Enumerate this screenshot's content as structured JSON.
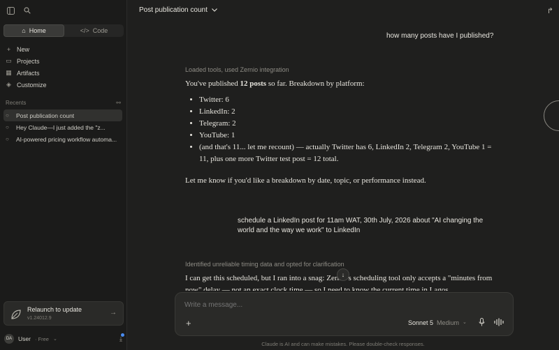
{
  "sidebar": {
    "modes": [
      {
        "label": "Home"
      },
      {
        "label": "Code"
      }
    ],
    "nav": [
      {
        "label": "New",
        "icon": "plus-icon"
      },
      {
        "label": "Projects",
        "icon": "folder-icon"
      },
      {
        "label": "Artifacts",
        "icon": "artifacts-icon"
      },
      {
        "label": "Customize",
        "icon": "customize-icon"
      }
    ],
    "recents_label": "Recents",
    "recents": [
      {
        "label": "Post publication count"
      },
      {
        "label": "Hey Claude—I just added the \"z..."
      },
      {
        "label": "AI-powered pricing workflow automa..."
      }
    ],
    "update": {
      "title": "Relaunch to update",
      "version": "v1.24012.9"
    },
    "user": {
      "initials": "DA",
      "name": "User",
      "plan": "· Free"
    }
  },
  "header": {
    "title": "Post publication count"
  },
  "conversation": {
    "user_1": "how many posts have I published?",
    "tool_1": "Loaded tools, used Zernio integration",
    "assistant_1": {
      "intro_pre": "You've published ",
      "intro_bold": "12 posts",
      "intro_post": " so far. Breakdown by platform:",
      "bullets": [
        "Twitter: 6",
        "LinkedIn: 2",
        "Telegram: 2",
        "YouTube: 1",
        "(and that's 11... let me recount) — actually Twitter has 6, LinkedIn 2, Telegram 2, YouTube 1 = 11, plus one more Twitter test post = 12 total."
      ],
      "closing": "Let me know if you'd like a breakdown by date, topic, or performance instead."
    },
    "user_2": "schedule a LinkedIn post for 11am WAT, 30th July, 2026 about \"AI changing the world and the way we work\" to LinkedIn",
    "tool_2": "Identified unreliable timing data and opted for clarification",
    "assistant_2": "I can get this scheduled, but I ran into a snag: Zernio's scheduling tool only accepts a \"minutes from now\" delay — not an exact clock time — so I need to know the current time in Lagos"
  },
  "composer": {
    "placeholder": "Write a message...",
    "model": "Sonnet 5",
    "effort": "Medium"
  },
  "disclaimer": "Claude is AI and can make mistakes. Please double-check responses."
}
